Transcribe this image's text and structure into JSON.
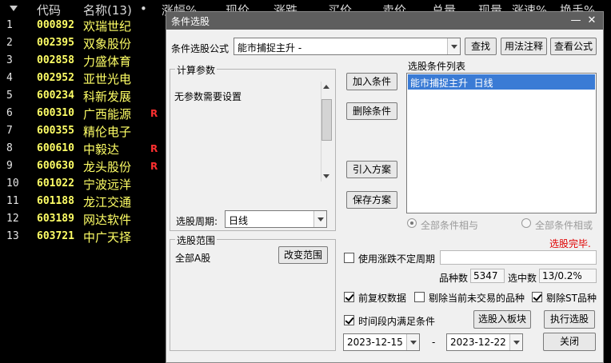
{
  "grid": {
    "headers": [
      "代码",
      "名称(13)",
      "•",
      "涨幅%",
      "现价",
      "涨跌",
      "买价",
      "卖价",
      "总量",
      "现量",
      "涨速%",
      "换手%"
    ],
    "rows": [
      {
        "idx": "1",
        "code": "000892",
        "name": "欢瑞世纪",
        "flag": ""
      },
      {
        "idx": "2",
        "code": "002395",
        "name": "双象股份",
        "flag": ""
      },
      {
        "idx": "3",
        "code": "002858",
        "name": "力盛体育",
        "flag": ""
      },
      {
        "idx": "4",
        "code": "002952",
        "name": "亚世光电",
        "flag": ""
      },
      {
        "idx": "5",
        "code": "600234",
        "name": "科新发展",
        "flag": ""
      },
      {
        "idx": "6",
        "code": "600310",
        "name": "广西能源",
        "flag": "R"
      },
      {
        "idx": "7",
        "code": "600355",
        "name": "精伦电子",
        "flag": ""
      },
      {
        "idx": "8",
        "code": "600610",
        "name": "中毅达",
        "flag": "R"
      },
      {
        "idx": "9",
        "code": "600630",
        "name": "龙头股份",
        "flag": "R"
      },
      {
        "idx": "10",
        "code": "601022",
        "name": "宁波远洋",
        "flag": ""
      },
      {
        "idx": "11",
        "code": "601188",
        "name": "龙江交通",
        "flag": ""
      },
      {
        "idx": "12",
        "code": "603189",
        "name": "网达软件",
        "flag": ""
      },
      {
        "idx": "13",
        "code": "603721",
        "name": "中广天择",
        "flag": ""
      }
    ]
  },
  "dialog": {
    "title": "条件选股",
    "minimize": "—",
    "close": "✕",
    "formula_label": "条件选股公式",
    "formula_value": "能市捕捉主升 -",
    "find": "查找",
    "usage": "用法注释",
    "view_formula": "查看公式",
    "params_group": "计算参数",
    "params_text": "无参数需要设置",
    "period_label": "选股周期:",
    "period_value": "日线",
    "add_condition": "加入条件",
    "delete_condition": "删除条件",
    "import_plan": "引入方案",
    "save_plan": "保存方案",
    "condition_list_label": "选股条件列表",
    "condition_items": [
      "能市捕捉主升  日线"
    ],
    "all_and": "全部条件相与",
    "all_or": "全部条件相或",
    "status": "选股完毕.",
    "scope_group": "选股范围",
    "scope_value": "全部A股",
    "change_scope": "改变范围",
    "use_uncertain_period": "使用涨跌不定周期",
    "total_label": "品种数",
    "total_value": "5347",
    "selected_label": "选中数",
    "selected_value": "13/0.2%",
    "pre_rights": "前复权数据",
    "exclude_untraded": "剔除当前未交易的品种",
    "exclude_st": "剔除ST品种",
    "time_range": "时间段内满足条件",
    "to_block": "选股入板块",
    "run": "执行选股",
    "date_from": "2023-12-15",
    "date_sep": "-",
    "date_to": "2023-12-22",
    "close_btn": "关闭"
  },
  "colors": {
    "code": "#ffff66",
    "flag": "#ff3030",
    "titlebar": "#5e5e5e",
    "list_selection": "#3a7bd5",
    "status": "#e00000"
  }
}
